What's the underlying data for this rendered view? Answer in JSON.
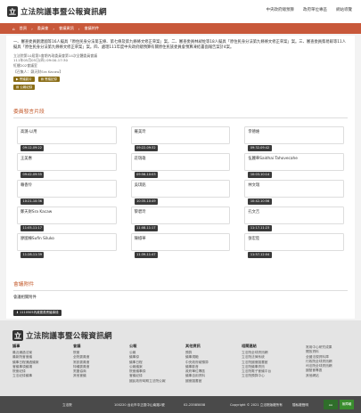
{
  "header": {
    "logo_text": "立法院議事暨公報資訊網",
    "nav": [
      "中央政府總預算",
      "政府單位專區",
      "網站導覽"
    ]
  },
  "breadcrumb": [
    "首頁",
    "委員會",
    "會議資訊",
    "會議附件"
  ],
  "meeting": {
    "description": "一、審查委員劉建國等16人擬具「原住民身分法第五條、第七條及第九條條文修正草案」案。二、審查委員林昶佐等18人擬具「原住民身分法第九條條文修正草案」案。三、審查委員蔡易餘等11人擬具「原住民身分法第九條條文修正草案」案。四、處理111年度中央政府總預算有關原住民族委員會預算凍結書面報告案計4案。",
    "session": "立法院第10屆第5會期內政委員會第14次全體委員會議",
    "datetime": "111年05月05日(四) 09:00-17:30",
    "location": "紅樓202會議室",
    "convener": "【召集人：鄭天財Sra Kacaw】",
    "buttons": [
      "會議影片",
      "會議記錄",
      "公報紀錄"
    ]
  },
  "speeches": {
    "title": "委員發言片段",
    "cards": [
      {
        "name": "高潞‧以用",
        "time": "09:12-09:22"
      },
      {
        "name": "羅美玲",
        "time": "09:22-09:32"
      },
      {
        "name": "李德維",
        "time": "09:32-09:42"
      },
      {
        "name": "王美惠",
        "time": "09:42-09:55"
      },
      {
        "name": "莊瑞雄",
        "time": "09:56-10:03"
      },
      {
        "name": "伍麗華Saidhai Tahovecahe",
        "time": "10:03-10:14"
      },
      {
        "name": "賴香伶",
        "time": "10:21-10:36"
      },
      {
        "name": "吳琪銘",
        "time": "10:35-10:49"
      },
      {
        "name": "林文瑞",
        "time": "10:42-10:56"
      },
      {
        "name": "鄭天財Sra Kacaw",
        "time": "11:05-11:17"
      },
      {
        "name": "黎碧玲",
        "time": "11:08-11:17"
      },
      {
        "name": "孔文吉",
        "time": "11:17-11:23"
      },
      {
        "name": "廖國棟Sufin Siluko",
        "time": "11:28-11:39"
      },
      {
        "name": "陳椒華",
        "time": "11:39-11:47"
      },
      {
        "name": "張宏陸",
        "time": "11:57-12:04"
      }
    ]
  },
  "attachments": {
    "title": "會議附件",
    "subtitle": "會議相關附件",
    "file": "1110505內政委員會議事錄"
  },
  "footer": {
    "logo_text": "立法院議事暨公報資訊網",
    "columns": [
      {
        "title": "議事",
        "items": [
          "最近通過法案",
          "最新院會會議",
          "議事日程通過議案",
          "會議事項議場",
          "院會紀錄",
          "立法紀錄議事"
        ]
      },
      {
        "title": "會議",
        "items": [
          "院會",
          "全院委員會",
          "常設委員會",
          "特種委員會",
          "黨團協商",
          "其他會議"
        ]
      },
      {
        "title": "公報",
        "items": [
          "公報",
          "議事錄",
          "議事日程",
          "公報議案",
          "院會議事錄",
          "會議紀錄",
          "國民政府時期立法院公報"
        ]
      },
      {
        "title": "其他資訊",
        "items": [
          "預算",
          "議事規範",
          "中央政府總預算",
          "議事影音",
          "政府單位專區",
          "議事自用資料",
          "國會圖書館"
        ]
      },
      {
        "title": "相關連結",
        "items": [
          "立法院全球資訊網",
          "立法院法律系統",
          "立法院國會圖書館",
          "立法院議事資訊",
          "立法院電子會議平台",
          "立法院預算中心"
        ]
      },
      {
        "title": "",
        "items": [
          "常用中心研究成果",
          "開放資料",
          "全國法規資料庫",
          "行政院全球資訊網",
          "司法院全球資訊網",
          "國發會專區",
          "其他網站"
        ]
      }
    ],
    "bar": {
      "org": "立法院",
      "address": "100220 台北市中正區中山南路1號",
      "phone": "02-23585858",
      "copyright": "Copyright © 2021 立法院版權所有",
      "privacy": "隱私權聲明",
      "badge1": "無障礙",
      "badge2": "AA"
    }
  }
}
